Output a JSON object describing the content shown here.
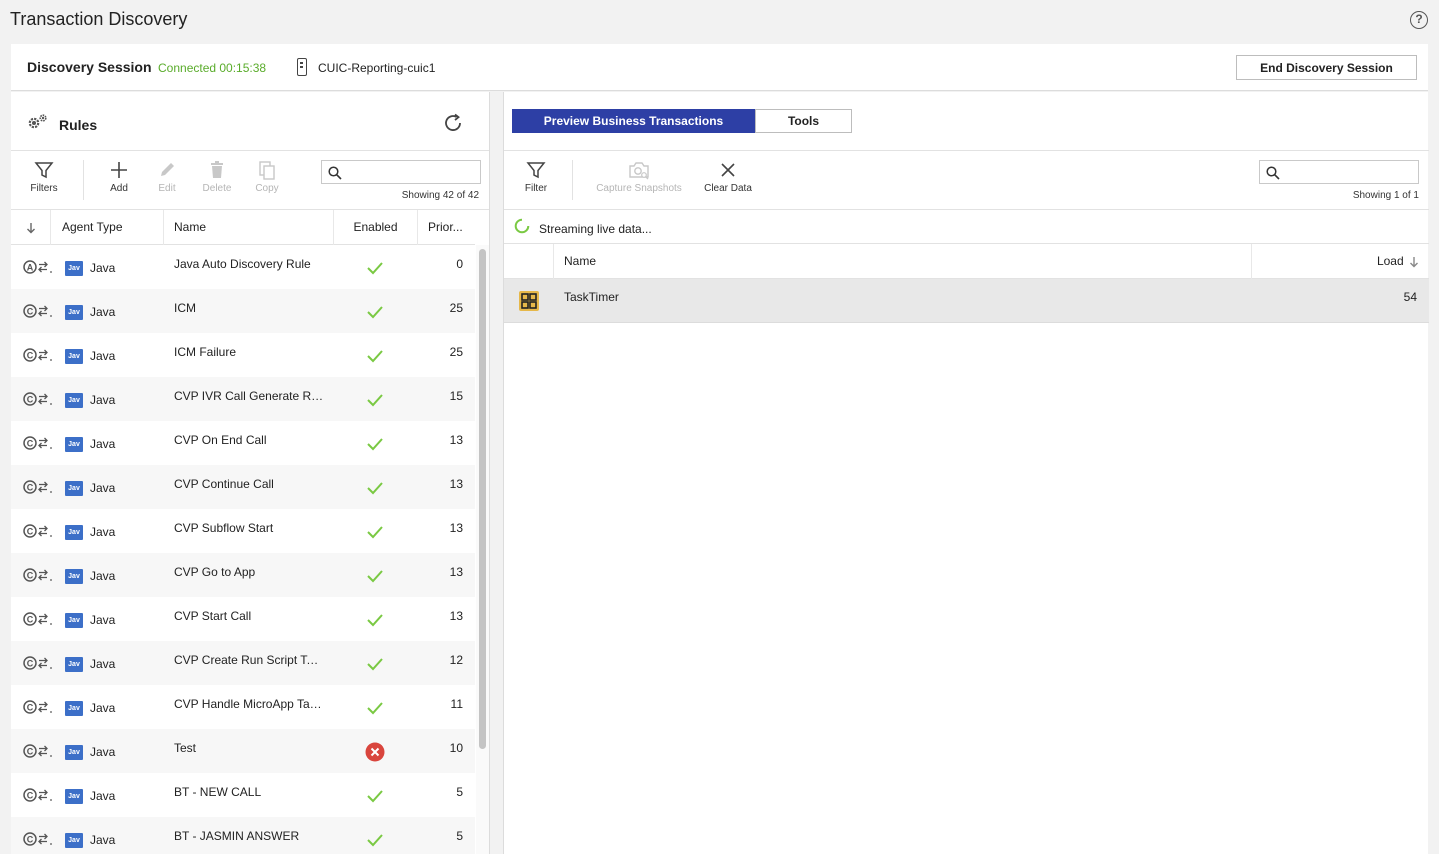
{
  "header": {
    "title": "Transaction Discovery"
  },
  "session": {
    "label": "Discovery Session",
    "status": "Connected 00:15:38",
    "device": "CUIC-Reporting-cuic1",
    "end_button": "End Discovery Session"
  },
  "rules": {
    "title": "Rules",
    "toolbar": {
      "filters": "Filters",
      "add": "Add",
      "edit": "Edit",
      "delete": "Delete",
      "copy": "Copy"
    },
    "search_placeholder": "",
    "showing": "Showing 42 of 42",
    "columns": {
      "agent_type": "Agent Type",
      "name": "Name",
      "enabled": "Enabled",
      "priority": "Prior..."
    },
    "rows": [
      {
        "type": "A",
        "agent_badge": "Jav",
        "agent": "Java",
        "name": "Java Auto Discovery Rule",
        "enabled": true,
        "priority": "0"
      },
      {
        "type": "C",
        "agent_badge": "Jav",
        "agent": "Java",
        "name": "ICM",
        "enabled": true,
        "priority": "25"
      },
      {
        "type": "C",
        "agent_badge": "Jav",
        "agent": "Java",
        "name": "ICM Failure",
        "enabled": true,
        "priority": "25"
      },
      {
        "type": "C",
        "agent_badge": "Jav",
        "agent": "Java",
        "name": "CVP IVR Call Generate Res...",
        "enabled": true,
        "priority": "15"
      },
      {
        "type": "C",
        "agent_badge": "Jav",
        "agent": "Java",
        "name": "CVP On End Call",
        "enabled": true,
        "priority": "13"
      },
      {
        "type": "C",
        "agent_badge": "Jav",
        "agent": "Java",
        "name": "CVP Continue Call",
        "enabled": true,
        "priority": "13"
      },
      {
        "type": "C",
        "agent_badge": "Jav",
        "agent": "Java",
        "name": "CVP Subflow Start",
        "enabled": true,
        "priority": "13"
      },
      {
        "type": "C",
        "agent_badge": "Jav",
        "agent": "Java",
        "name": "CVP Go to App",
        "enabled": true,
        "priority": "13"
      },
      {
        "type": "C",
        "agent_badge": "Jav",
        "agent": "Java",
        "name": "CVP Start Call",
        "enabled": true,
        "priority": "13"
      },
      {
        "type": "C",
        "agent_badge": "Jav",
        "agent": "Java",
        "name": "CVP Create Run Script Task",
        "enabled": true,
        "priority": "12"
      },
      {
        "type": "C",
        "agent_badge": "Jav",
        "agent": "Java",
        "name": "CVP Handle MicroApp Tas...",
        "enabled": true,
        "priority": "11"
      },
      {
        "type": "C",
        "agent_badge": "Jav",
        "agent": "Java",
        "name": "Test",
        "enabled": false,
        "priority": "10"
      },
      {
        "type": "C",
        "agent_badge": "Jav",
        "agent": "Java",
        "name": "BT - NEW CALL",
        "enabled": true,
        "priority": "5"
      },
      {
        "type": "C",
        "agent_badge": "Jav",
        "agent": "Java",
        "name": "BT - JASMIN ANSWER",
        "enabled": true,
        "priority": "5"
      }
    ]
  },
  "preview": {
    "tabs": [
      {
        "label": "Preview Business Transactions",
        "active": true
      },
      {
        "label": "Tools",
        "active": false
      }
    ],
    "toolbar": {
      "filter": "Filter",
      "capture": "Capture Snapshots",
      "clear": "Clear Data"
    },
    "showing": "Showing 1 of 1",
    "streaming": "Streaming live data...",
    "columns": {
      "name": "Name",
      "load": "Load"
    },
    "rows": [
      {
        "name": "TaskTimer",
        "load": "54"
      }
    ]
  },
  "colors": {
    "accent": "#2d3fa5",
    "connected": "#5aac2b",
    "enabled_check": "#7ac943",
    "disabled_x": "#d9453d",
    "java_badge": "#3c6fc8"
  }
}
